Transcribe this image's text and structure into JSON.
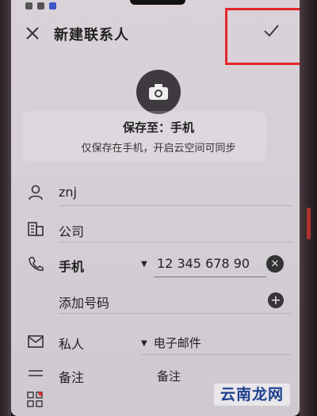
{
  "header": {
    "title": "新建联系人"
  },
  "save_info": {
    "title": "保存至：手机",
    "note": "仅保存在手机，开启云空间可同步"
  },
  "fields": {
    "name_value": "znj",
    "company_placeholder": "公司",
    "phone_label": "手机",
    "phone_value": "12 345 678 90",
    "add_number_label": "添加号码",
    "email_label": "私人",
    "email_placeholder": "电子邮件",
    "notes_label": "备注",
    "notes_placeholder": "备注"
  },
  "watermark": {
    "text": "云南龙网"
  },
  "colors": {
    "highlight": "#e3262b",
    "screen_bg": "#d6d0d7",
    "watermark_text": "#1c3f8f"
  }
}
